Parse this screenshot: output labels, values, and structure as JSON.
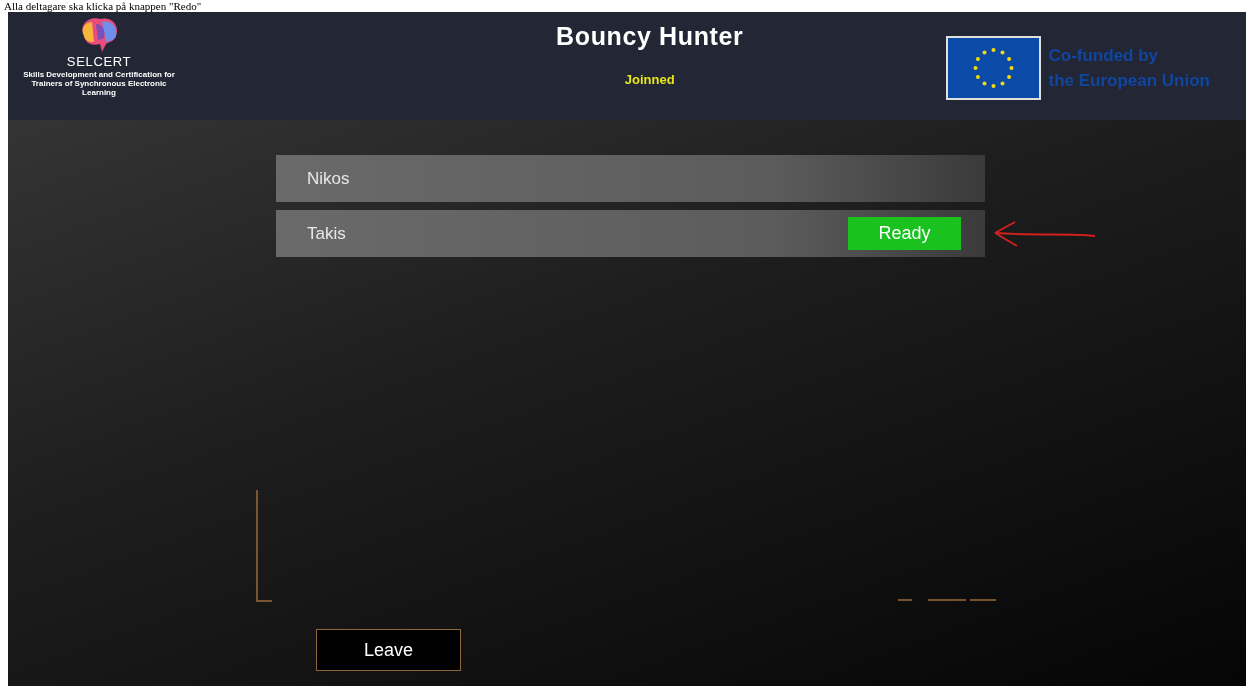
{
  "caption": "Alla deltagare ska klicka på knappen \"Redo\"",
  "header": {
    "logo_name": "SELCERT",
    "logo_tagline": "Skills Development and Certification for Trainers of Synchronous Electronic Learning",
    "title": "Bouncy Hunter",
    "status": "Joinned",
    "funding": [
      "Co-funded by",
      "the European Union"
    ]
  },
  "players": [
    {
      "name": "Nikos",
      "ready": false
    },
    {
      "name": "Takis",
      "ready": true,
      "ready_label": "Ready"
    }
  ],
  "leave_button": "Leave"
}
